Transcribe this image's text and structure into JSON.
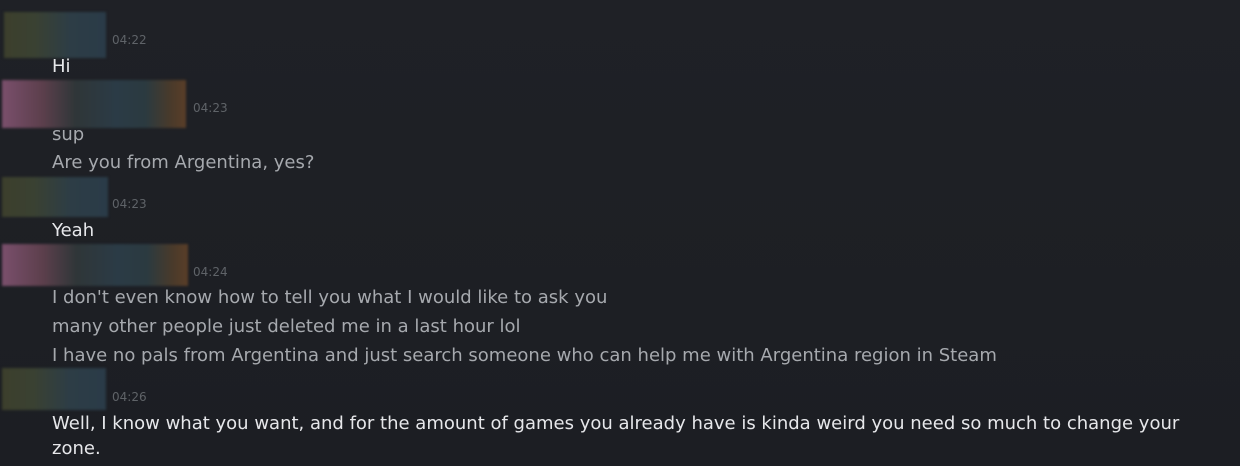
{
  "chat": {
    "groups": [
      {
        "time": "04:22",
        "messages": [
          "Hi"
        ]
      },
      {
        "time": "04:23",
        "messages": [
          "sup",
          "Are you from Argentina, yes?"
        ]
      },
      {
        "time": "04:23",
        "messages": [
          "Yeah"
        ]
      },
      {
        "time": "04:24",
        "messages": [
          "I don't even know how to tell you what I would like to ask you",
          "many other people just deleted me in a last hour lol",
          "I have no pals from Argentina and just search someone who can help me with Argentina region in Steam"
        ]
      },
      {
        "time": "04:26",
        "messages": [
          "Well, I know what you want, and for the amount of games you already have is kinda weird you need so much to change your zone."
        ]
      }
    ]
  },
  "colors": {
    "background": "#1e2025",
    "own_message": "#e6e7ea",
    "other_message": "#a6a9ae",
    "timestamp": "#5f6368"
  }
}
